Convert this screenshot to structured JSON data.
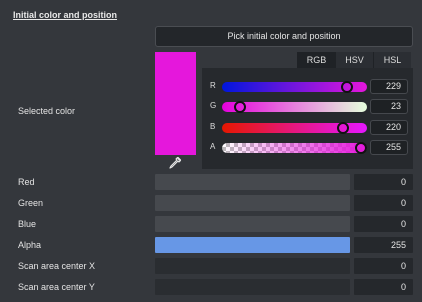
{
  "section_title": "Initial color and position",
  "pick_button_label": "Pick initial color and position",
  "selected_color_label": "Selected color",
  "selected_color_hex": "#e517dc",
  "color_tabs": [
    "RGB",
    "HSV",
    "HSL"
  ],
  "active_tab": "RGB",
  "channels": [
    {
      "label": "R",
      "value": "229",
      "fraction": 0.898
    },
    {
      "label": "G",
      "value": "23",
      "fraction": 0.09
    },
    {
      "label": "B",
      "value": "220",
      "fraction": 0.863
    },
    {
      "label": "A",
      "value": "255",
      "fraction": 1.0
    }
  ],
  "rows": [
    {
      "label": "Red",
      "value": "0"
    },
    {
      "label": "Green",
      "value": "0"
    },
    {
      "label": "Blue",
      "value": "0"
    },
    {
      "label": "Alpha",
      "value": "255"
    },
    {
      "label": "Scan area center X",
      "value": "0"
    },
    {
      "label": "Scan area center Y",
      "value": "0"
    }
  ],
  "icons": {
    "eyedropper": "eyedropper-icon"
  }
}
